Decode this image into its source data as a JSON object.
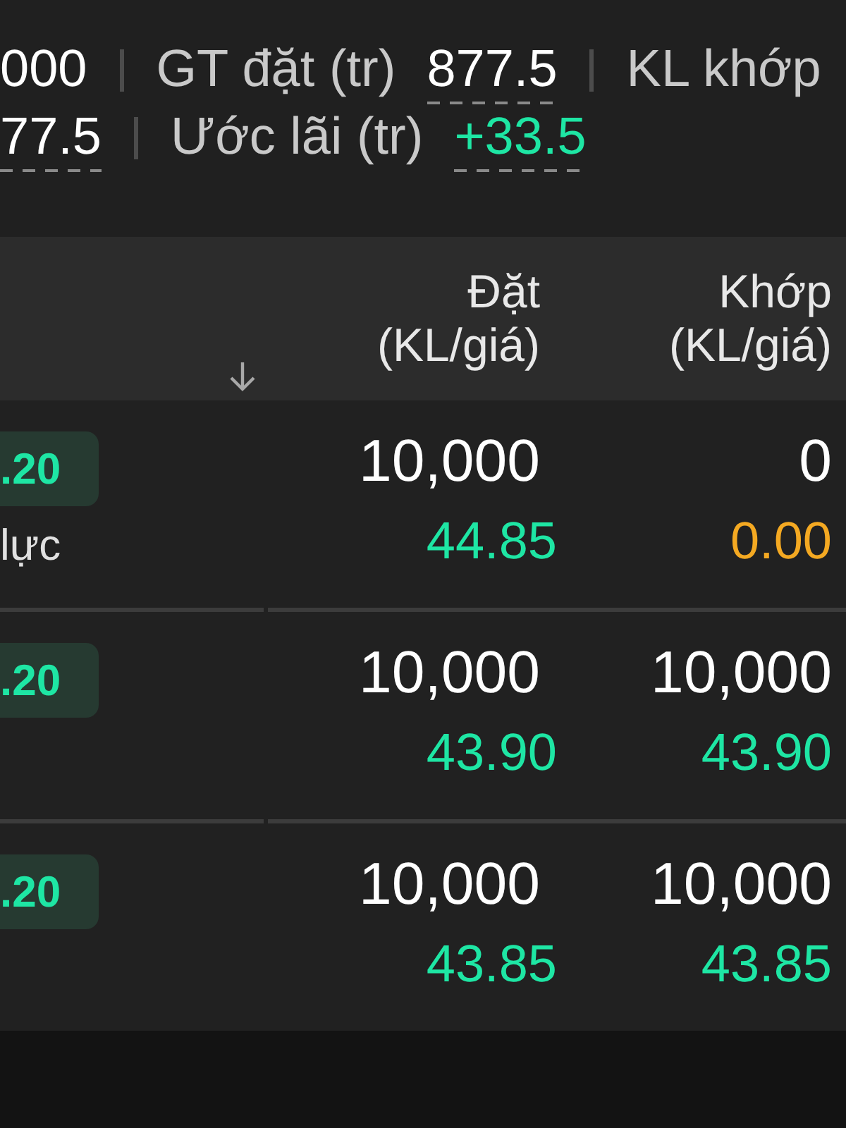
{
  "summary": [
    [
      {
        "kind": "value",
        "text": "000",
        "underlined": false,
        "color": "#ffffff"
      },
      {
        "kind": "label",
        "text": "GT đặt (tr)"
      },
      {
        "kind": "value",
        "text": "877.5",
        "underlined": true,
        "color": "#ffffff"
      },
      {
        "kind": "label",
        "text": "KL khớp"
      }
    ],
    [
      {
        "kind": "value",
        "text": "77.5",
        "underlined": true,
        "color": "#ffffff"
      },
      {
        "kind": "label",
        "text": "Ước lãi (tr)"
      },
      {
        "kind": "value",
        "text": "+33.5",
        "underlined": true,
        "color": "#1ee6a4"
      }
    ]
  ],
  "orders": {
    "columns": [
      "Đặt (KL/giá)",
      "Khớp (KL/giá)"
    ],
    "rows": [
      {
        "badge": ".20",
        "note": "lực",
        "placed": {
          "qty": "10,000",
          "price": "44.85",
          "color": "#1ee6a4"
        },
        "matched": {
          "qty": "0",
          "price": "0.00",
          "color": "#f4a922"
        }
      },
      {
        "badge": ".20",
        "placed": {
          "qty": "10,000",
          "price": "43.90",
          "color": "#1ee6a4"
        },
        "matched": {
          "qty": "10,000",
          "price": "43.90",
          "color": "#1ee6a4"
        }
      },
      {
        "badge": ".20",
        "placed": {
          "qty": "10,000",
          "price": "43.85",
          "color": "#1ee6a4"
        },
        "matched": {
          "qty": "10,000",
          "price": "43.85",
          "color": "#1ee6a4"
        }
      }
    ]
  }
}
